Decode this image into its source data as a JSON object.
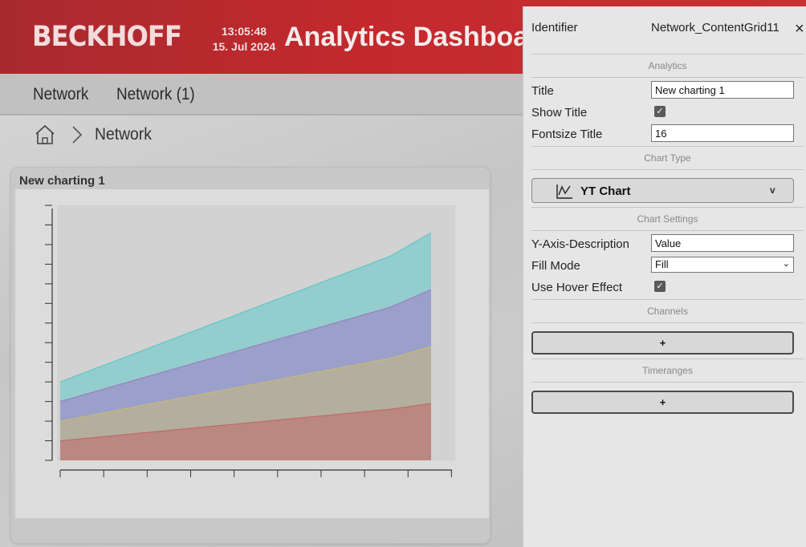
{
  "header": {
    "logo": "BECKHOFF",
    "time": "13:05:48",
    "date": "15. Jul 2024",
    "title": "Analytics Dashboa"
  },
  "nav": {
    "items": [
      "Network",
      "Network (1)"
    ]
  },
  "breadcrumb": {
    "label": "Network"
  },
  "card": {
    "title": "New charting 1"
  },
  "chart_data": {
    "type": "area",
    "title": "New charting 1",
    "xlabel": "",
    "ylabel": "",
    "x": [
      0,
      1,
      2,
      3,
      4,
      5,
      6,
      7,
      8,
      9
    ],
    "series": [
      {
        "color": "#c06a6a",
        "values": [
          1,
          1.2,
          1.4,
          1.6,
          1.8,
          2.0,
          2.2,
          2.4,
          2.6,
          2.9
        ]
      },
      {
        "color": "#c8b978",
        "values": [
          2,
          2.4,
          2.8,
          3.2,
          3.6,
          4.0,
          4.4,
          4.8,
          5.2,
          5.8
        ]
      },
      {
        "color": "#a07cc8",
        "values": [
          3,
          3.6,
          4.2,
          4.8,
          5.4,
          6.0,
          6.6,
          7.2,
          7.8,
          8.7
        ]
      },
      {
        "color": "#5ec8c8",
        "values": [
          4,
          4.8,
          5.6,
          6.4,
          7.2,
          8.0,
          8.8,
          9.6,
          10.4,
          11.6
        ]
      }
    ],
    "ylim": [
      0,
      13
    ],
    "grid": false,
    "legend": "none"
  },
  "panel": {
    "identifier_label": "Identifier",
    "identifier_value": "Network_ContentGrid11",
    "close": "×",
    "sections": {
      "analytics": "Analytics",
      "chart_type": "Chart Type",
      "chart_settings": "Chart Settings",
      "channels": "Channels",
      "timeranges": "Timeranges"
    },
    "title_label": "Title",
    "title_value": "New charting 1",
    "show_title_label": "Show Title",
    "show_title_checked": true,
    "fontsize_label": "Fontsize Title",
    "fontsize_value": "16",
    "chart_type_label": "YT Chart",
    "chart_type_chevron": "v",
    "y_axis_label": "Y-Axis-Description",
    "y_axis_value": "Value",
    "fill_mode_label": "Fill Mode",
    "fill_mode_value": "Fill",
    "hover_label": "Use Hover Effect",
    "hover_checked": true,
    "add_label": "+"
  }
}
